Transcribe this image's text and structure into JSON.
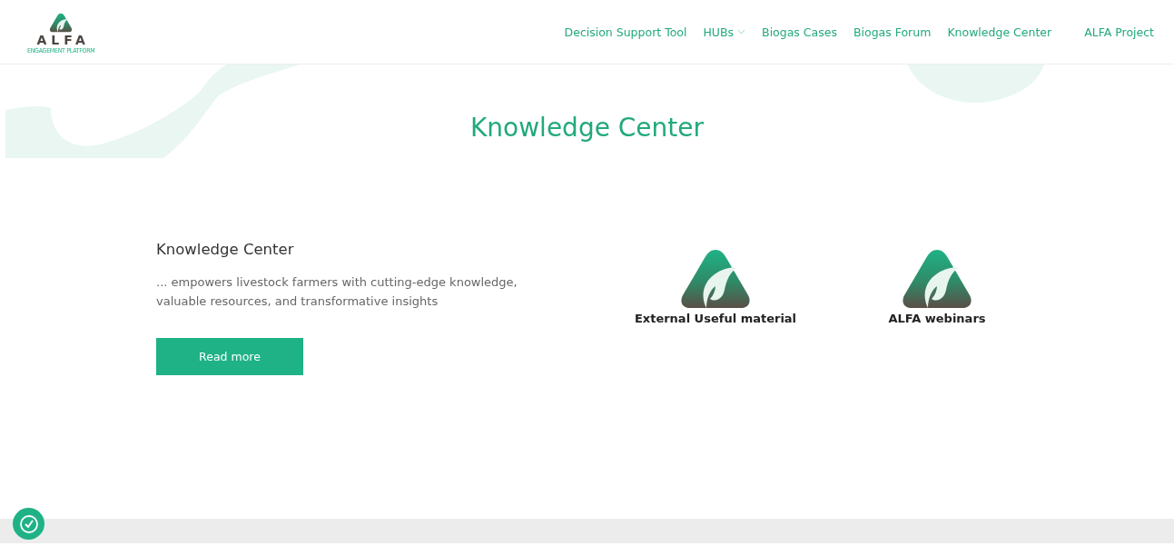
{
  "logo": {
    "name": "ALFA",
    "tagline": "ENGAGEMENT PLATFORM"
  },
  "nav": [
    {
      "label": "Decision Support Tool",
      "kind": "link"
    },
    {
      "label": "HUBs",
      "kind": "dropdown"
    },
    {
      "label": "Biogas Cases",
      "kind": "link"
    },
    {
      "label": "Biogas Forum",
      "kind": "link"
    },
    {
      "label": "Knowledge Center",
      "kind": "link"
    },
    {
      "label": "ALFA Project",
      "kind": "link"
    }
  ],
  "hero": {
    "title": "Knowledge Center"
  },
  "intro": {
    "heading": "Knowledge Center",
    "text": "... empowers livestock farmers with cutting-edge knowledge, valuable resources, and transformative insights",
    "button": "Read more"
  },
  "tiles": [
    {
      "label": "External Useful material"
    },
    {
      "label": "ALFA webinars"
    }
  ]
}
